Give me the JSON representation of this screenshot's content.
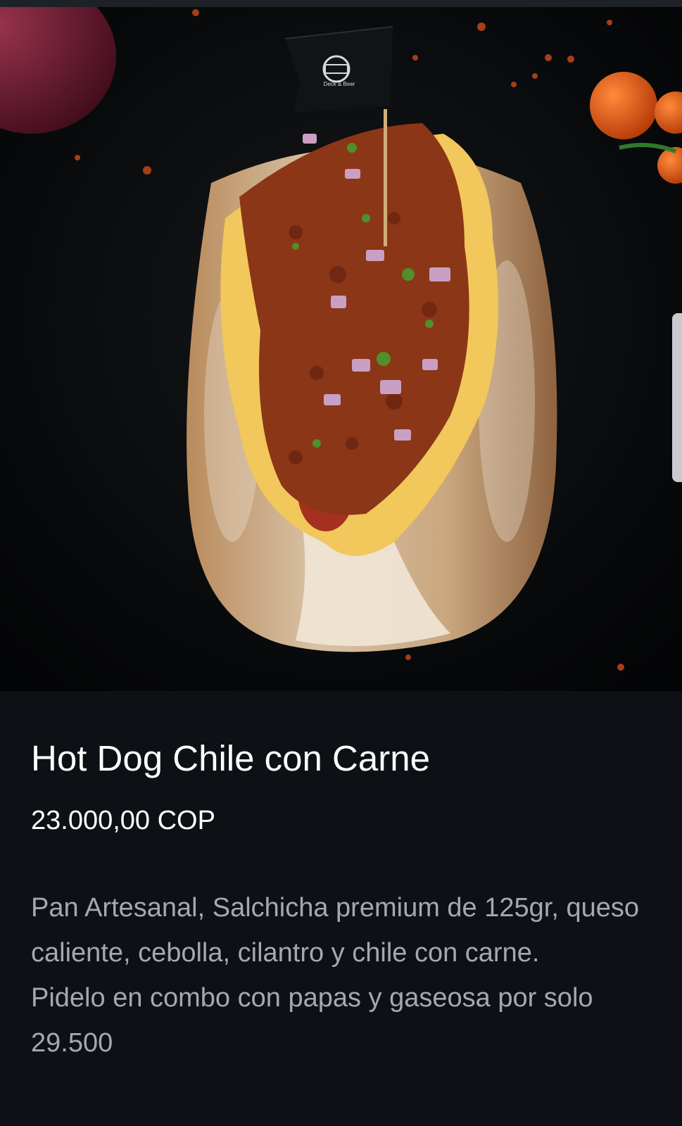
{
  "product": {
    "title": "Hot Dog Chile con Carne",
    "price": "23.000,00 COP",
    "description": [
      "Pan Artesanal, Salchicha premium de 125gr, queso caliente, cebolla, cilantro y chile con carne.",
      "Pidelo en combo con papas y gaseosa por solo 29.500"
    ]
  },
  "image": {
    "alt": "Hot dog chile con carne"
  },
  "flag": {
    "brand_text": "Deck & Beer"
  },
  "colors": {
    "background": "#0d1115",
    "title": "#ffffff",
    "description": "#a3a9ae"
  }
}
